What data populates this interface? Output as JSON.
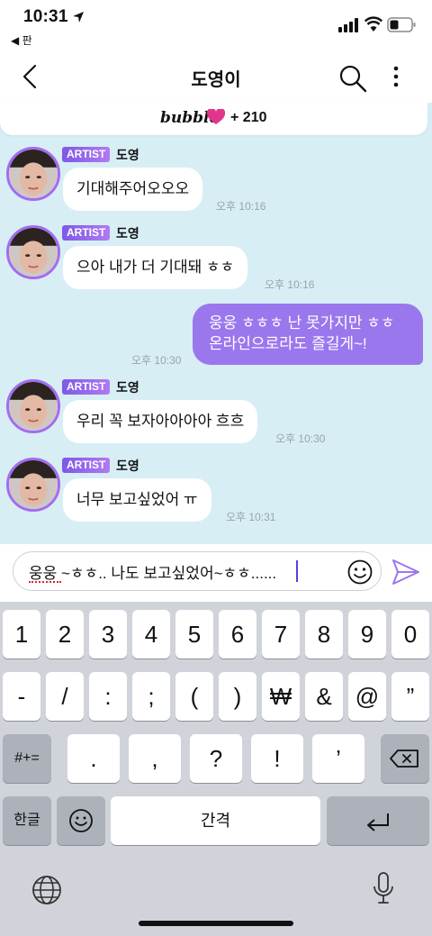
{
  "status_bar": {
    "time": "10:31",
    "back_app": "◀ 판",
    "icons": [
      "location-arrow-icon",
      "signal-icon",
      "wifi-icon",
      "battery-icon"
    ]
  },
  "header": {
    "title": "도영이",
    "icons": [
      "back-chevron-icon",
      "search-icon",
      "more-vertical-icon"
    ]
  },
  "banner": {
    "brand": "bubble",
    "icon": "heart-icon",
    "heart_color": "#e0358a",
    "count": "+ 210"
  },
  "messages": [
    {
      "tag": "ARTIST",
      "sender": "도영",
      "text": "기대해주어오오오",
      "time": "오후 10:16"
    },
    {
      "tag": "ARTIST",
      "sender": "도영",
      "text": "으아 내가 더 기대돼 ㅎㅎ",
      "time": "오후 10:16"
    },
    {
      "tag": "ARTIST",
      "sender": "도영",
      "text": "우리 꼭 보자아아아아 흐흐",
      "time": "오후 10:30"
    },
    {
      "tag": "ARTIST",
      "sender": "도영",
      "text": "너무 보고싶었어 ㅠ",
      "time": "오후 10:31"
    }
  ],
  "my_message": {
    "line1": "웅웅 ㅎㅎㅎ 난 못가지만 ㅎㅎ",
    "line2": "온라인으로라도 즐길게~!",
    "time": "오후 10:30"
  },
  "composer": {
    "text": "웅웅 ~ㅎㅎ.. 나도 보고싶었어~ㅎㅎ......",
    "icons": [
      "emoji-icon",
      "send-icon"
    ]
  },
  "keyboard": {
    "row1": [
      "1",
      "2",
      "3",
      "4",
      "5",
      "6",
      "7",
      "8",
      "9",
      "0"
    ],
    "row2": [
      "-",
      "/",
      ":",
      ";",
      "(",
      ")",
      "₩",
      "&",
      "@",
      "”"
    ],
    "row3": [
      ".",
      ",",
      "?",
      "!",
      "’"
    ],
    "shift_label": "#+=",
    "lang_label": "한글",
    "space_label": "간격",
    "icons": [
      "delete-icon",
      "emoji-keyboard-icon",
      "return-icon",
      "globe-icon",
      "microphone-icon"
    ]
  },
  "colors": {
    "accent": "#9b77ee",
    "chat_bg": "#d7eef5",
    "keyboard_bg": "#d0d3d9"
  }
}
